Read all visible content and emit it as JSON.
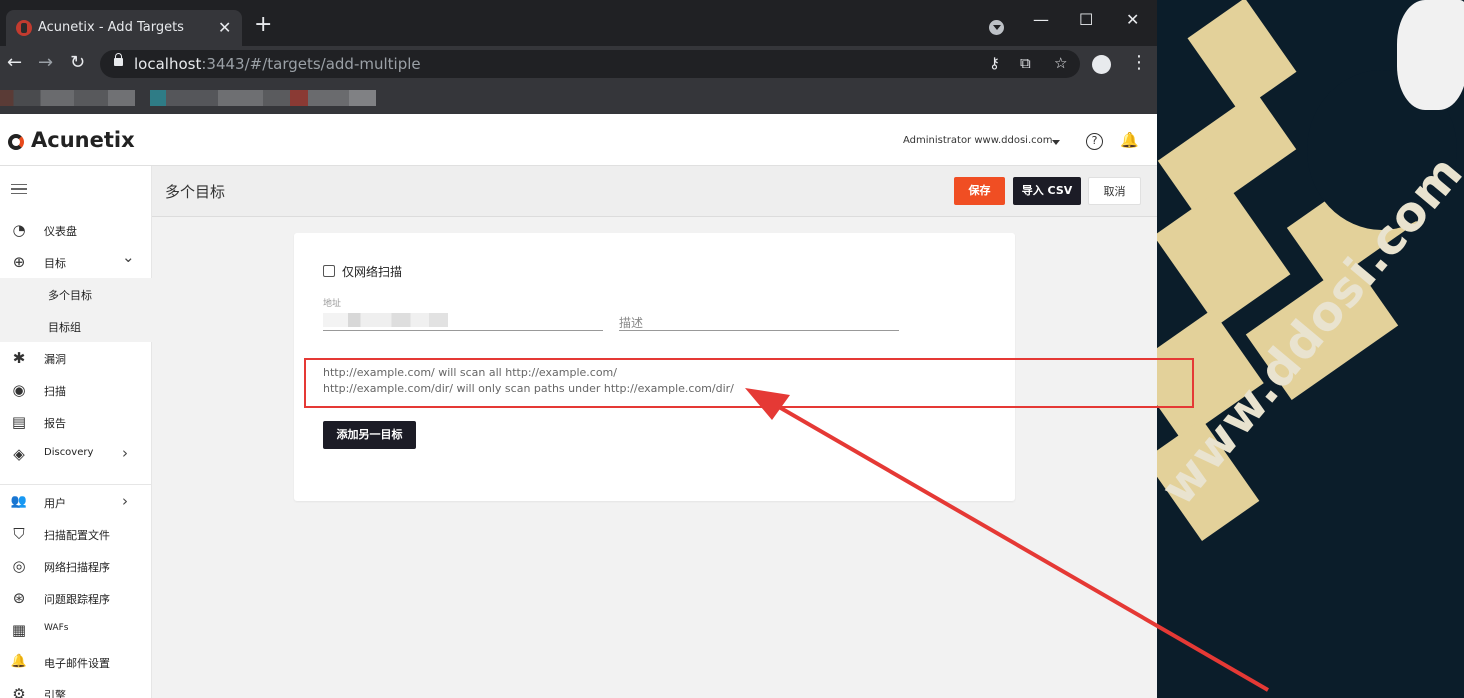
{
  "browser": {
    "tab_title": "Acunetix - Add Targets",
    "tab_close": "✕",
    "new_tab": "+",
    "url_host": "localhost",
    "url_rest": ":3443/#/targets/add-multiple"
  },
  "window_controls": {
    "minimize": "—",
    "maximize": "☐",
    "close": "✕"
  },
  "app": {
    "logo": "Acunetix",
    "user": "Administrator www.ddosi.com",
    "help": "?"
  },
  "sidebar": {
    "items": [
      {
        "label": "仪表盘",
        "icon": "dashboard-icon",
        "glyph": "◔"
      },
      {
        "label": "目标",
        "icon": "target-icon",
        "glyph": "⊕",
        "arrow": "⌄"
      },
      {
        "label": "多个目标"
      },
      {
        "label": "目标组"
      },
      {
        "label": "漏洞",
        "icon": "bug-icon",
        "glyph": "✱"
      },
      {
        "label": "扫描",
        "icon": "scan-icon",
        "glyph": "◉"
      },
      {
        "label": "报告",
        "icon": "report-icon",
        "glyph": "▤"
      },
      {
        "label": "Discovery",
        "icon": "compass-icon",
        "glyph": "◈",
        "arrow": "›"
      },
      {
        "label": "用户",
        "icon": "users-icon",
        "glyph": "👥",
        "arrow": "›"
      },
      {
        "label": "扫描配置文件",
        "icon": "shield-icon",
        "glyph": "⛉"
      },
      {
        "label": "网络扫描程序",
        "icon": "network-scanner-icon",
        "glyph": "◎"
      },
      {
        "label": "问题跟踪程序",
        "icon": "issue-tracker-icon",
        "glyph": "⊛"
      },
      {
        "label": "WAFs",
        "icon": "waf-icon",
        "glyph": "▦"
      },
      {
        "label": "电子邮件设置",
        "icon": "bell-outline-icon",
        "glyph": "🔔"
      },
      {
        "label": "引擎",
        "icon": "engine-icon",
        "glyph": "⚙"
      }
    ]
  },
  "page": {
    "title": "多个目标",
    "save": "保存",
    "import_csv": "导入 CSV",
    "cancel": "取消"
  },
  "form": {
    "network_only_label": "仅网络扫描",
    "address_label": "地址",
    "description_placeholder": "描述",
    "hint_1": "http://example.com/ will scan all http://example.com/",
    "hint_2": "http://example.com/dir/ will only scan paths under http://example.com/dir/",
    "add_another": "添加另一目标"
  },
  "wallpaper": {
    "text": "www.ddosi.com"
  },
  "colors": {
    "accent": "#f04e23",
    "dark_button": "#1c1c26",
    "annotation": "#e53935"
  }
}
